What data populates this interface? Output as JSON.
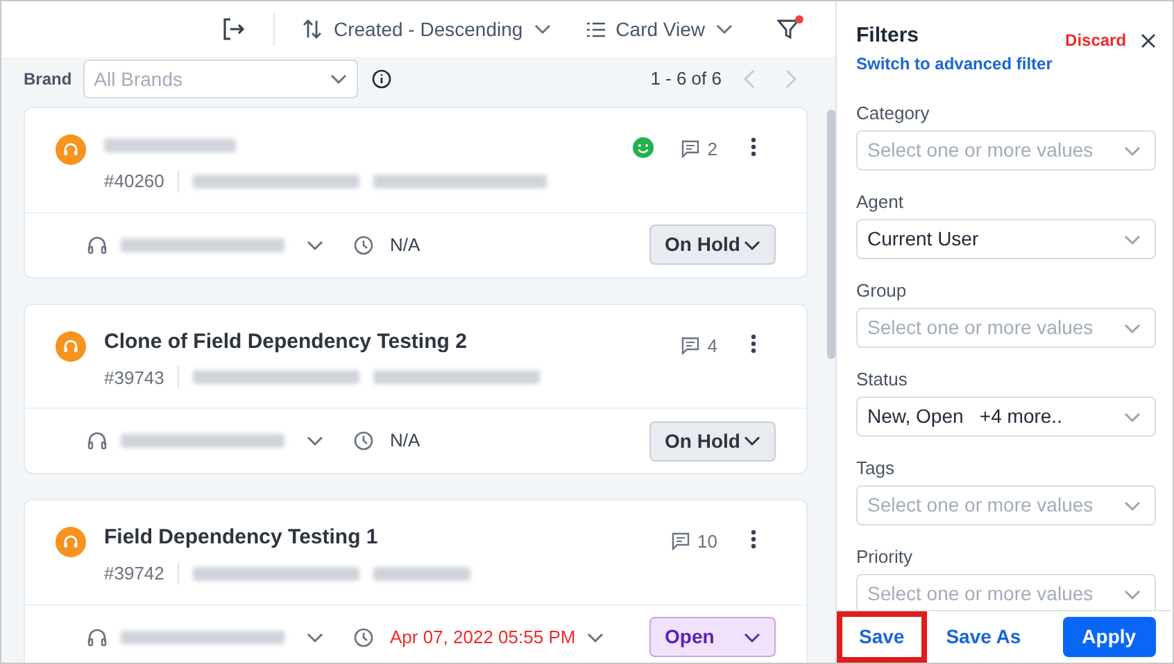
{
  "toolbar": {
    "sort": "Created - Descending",
    "view": "Card View",
    "filter_active": true
  },
  "brand_filter": {
    "label": "Brand",
    "placeholder": "All Brands"
  },
  "pagination": {
    "range": "1 - 6 of 6"
  },
  "tickets": [
    {
      "id": "#40260",
      "satisfied": true,
      "comments": "2",
      "due": "N/A",
      "overdue": false,
      "due_dropdown": false,
      "status": {
        "label": "On Hold",
        "kind": "on_hold"
      }
    },
    {
      "title": "Clone of Field Dependency Testing 2",
      "id": "#39743",
      "satisfied": false,
      "comments": "4",
      "due": "N/A",
      "overdue": false,
      "due_dropdown": false,
      "status": {
        "label": "On Hold",
        "kind": "on_hold"
      }
    },
    {
      "title": "Field Dependency Testing 1",
      "id": "#39742",
      "satisfied": false,
      "comments": "10",
      "due": "Apr 07, 2022 05:55 PM",
      "overdue": true,
      "due_dropdown": true,
      "status": {
        "label": "Open",
        "kind": "open"
      }
    }
  ],
  "filters_panel": {
    "title": "Filters",
    "discard": "Discard",
    "advanced_link": "Switch to advanced filter",
    "fields": [
      {
        "label": "Category",
        "placeholder": "Select one or more values"
      },
      {
        "label": "Agent",
        "value": "Current User"
      },
      {
        "label": "Group",
        "placeholder": "Select one or more values"
      },
      {
        "label": "Status",
        "value": "New, Open   +4 more.."
      },
      {
        "label": "Tags",
        "placeholder": "Select one or more values"
      },
      {
        "label": "Priority",
        "placeholder": "Select one or more values"
      }
    ],
    "buttons": [
      {
        "label": "Save",
        "kind": "link",
        "highlighted": true
      },
      {
        "label": "Save As",
        "kind": "link",
        "highlighted": false
      },
      {
        "label": "Apply",
        "kind": "primary",
        "highlighted": false
      }
    ]
  }
}
